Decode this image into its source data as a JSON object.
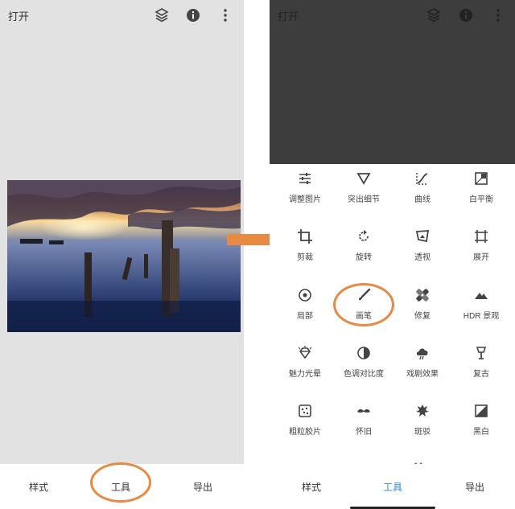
{
  "left": {
    "title": "打开",
    "icons": [
      "layers-icon",
      "info-icon",
      "more-vert-icon"
    ],
    "nav": {
      "styles": "样式",
      "tools": "工具",
      "export": "导出"
    }
  },
  "right": {
    "title": "打开",
    "icons": [
      "layers-icon",
      "info-icon",
      "more-vert-icon"
    ],
    "tools": [
      {
        "label": "调整图片",
        "icon": "tune-icon"
      },
      {
        "label": "突出细节",
        "icon": "details-icon"
      },
      {
        "label": "曲线",
        "icon": "curves-icon"
      },
      {
        "label": "白平衡",
        "icon": "white-balance-icon"
      },
      {
        "label": "剪裁",
        "icon": "crop-icon"
      },
      {
        "label": "旋转",
        "icon": "rotate-icon"
      },
      {
        "label": "透视",
        "icon": "perspective-icon"
      },
      {
        "label": "展开",
        "icon": "expand-icon"
      },
      {
        "label": "局部",
        "icon": "selective-icon"
      },
      {
        "label": "画笔",
        "icon": "brush-icon"
      },
      {
        "label": "修复",
        "icon": "healing-icon"
      },
      {
        "label": "HDR 景观",
        "icon": "hdr-icon"
      },
      {
        "label": "魅力光晕",
        "icon": "glamour-glow-icon"
      },
      {
        "label": "色调对比度",
        "icon": "tonal-contrast-icon"
      },
      {
        "label": "戏剧效果",
        "icon": "drama-icon"
      },
      {
        "label": "复古",
        "icon": "vintage-icon"
      },
      {
        "label": "粗粒胶片",
        "icon": "grainy-film-icon"
      },
      {
        "label": "怀旧",
        "icon": "retrolux-icon"
      },
      {
        "label": "斑驳",
        "icon": "grunge-icon"
      },
      {
        "label": "黑白",
        "icon": "black-white-icon"
      }
    ],
    "nav": {
      "styles": "样式",
      "tools": "工具",
      "export": "导出"
    },
    "active_nav_color": "#2e86de"
  },
  "colors": {
    "annotation": "#e98a43",
    "dark_preview": "#3d3d3d",
    "canvas": "#e2e2e2"
  }
}
